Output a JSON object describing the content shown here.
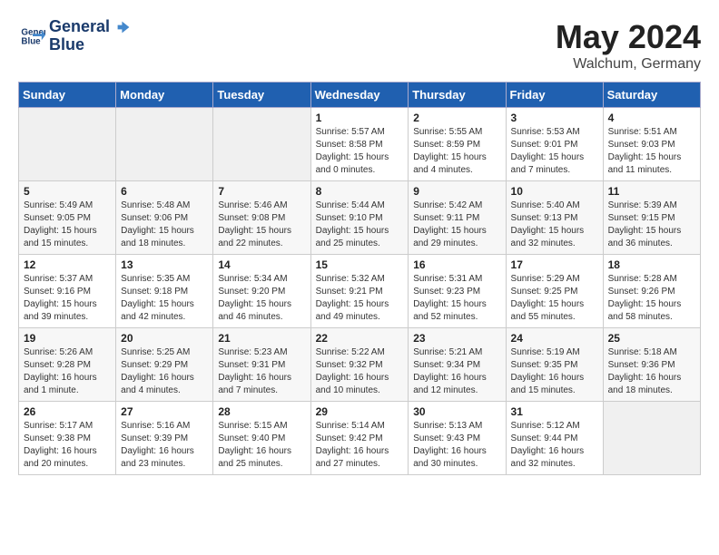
{
  "header": {
    "logo_line1": "General",
    "logo_line2": "Blue",
    "month": "May 2024",
    "location": "Walchum, Germany"
  },
  "weekdays": [
    "Sunday",
    "Monday",
    "Tuesday",
    "Wednesday",
    "Thursday",
    "Friday",
    "Saturday"
  ],
  "weeks": [
    [
      {
        "day": "",
        "info": ""
      },
      {
        "day": "",
        "info": ""
      },
      {
        "day": "",
        "info": ""
      },
      {
        "day": "1",
        "info": "Sunrise: 5:57 AM\nSunset: 8:58 PM\nDaylight: 15 hours\nand 0 minutes."
      },
      {
        "day": "2",
        "info": "Sunrise: 5:55 AM\nSunset: 8:59 PM\nDaylight: 15 hours\nand 4 minutes."
      },
      {
        "day": "3",
        "info": "Sunrise: 5:53 AM\nSunset: 9:01 PM\nDaylight: 15 hours\nand 7 minutes."
      },
      {
        "day": "4",
        "info": "Sunrise: 5:51 AM\nSunset: 9:03 PM\nDaylight: 15 hours\nand 11 minutes."
      }
    ],
    [
      {
        "day": "5",
        "info": "Sunrise: 5:49 AM\nSunset: 9:05 PM\nDaylight: 15 hours\nand 15 minutes."
      },
      {
        "day": "6",
        "info": "Sunrise: 5:48 AM\nSunset: 9:06 PM\nDaylight: 15 hours\nand 18 minutes."
      },
      {
        "day": "7",
        "info": "Sunrise: 5:46 AM\nSunset: 9:08 PM\nDaylight: 15 hours\nand 22 minutes."
      },
      {
        "day": "8",
        "info": "Sunrise: 5:44 AM\nSunset: 9:10 PM\nDaylight: 15 hours\nand 25 minutes."
      },
      {
        "day": "9",
        "info": "Sunrise: 5:42 AM\nSunset: 9:11 PM\nDaylight: 15 hours\nand 29 minutes."
      },
      {
        "day": "10",
        "info": "Sunrise: 5:40 AM\nSunset: 9:13 PM\nDaylight: 15 hours\nand 32 minutes."
      },
      {
        "day": "11",
        "info": "Sunrise: 5:39 AM\nSunset: 9:15 PM\nDaylight: 15 hours\nand 36 minutes."
      }
    ],
    [
      {
        "day": "12",
        "info": "Sunrise: 5:37 AM\nSunset: 9:16 PM\nDaylight: 15 hours\nand 39 minutes."
      },
      {
        "day": "13",
        "info": "Sunrise: 5:35 AM\nSunset: 9:18 PM\nDaylight: 15 hours\nand 42 minutes."
      },
      {
        "day": "14",
        "info": "Sunrise: 5:34 AM\nSunset: 9:20 PM\nDaylight: 15 hours\nand 46 minutes."
      },
      {
        "day": "15",
        "info": "Sunrise: 5:32 AM\nSunset: 9:21 PM\nDaylight: 15 hours\nand 49 minutes."
      },
      {
        "day": "16",
        "info": "Sunrise: 5:31 AM\nSunset: 9:23 PM\nDaylight: 15 hours\nand 52 minutes."
      },
      {
        "day": "17",
        "info": "Sunrise: 5:29 AM\nSunset: 9:25 PM\nDaylight: 15 hours\nand 55 minutes."
      },
      {
        "day": "18",
        "info": "Sunrise: 5:28 AM\nSunset: 9:26 PM\nDaylight: 15 hours\nand 58 minutes."
      }
    ],
    [
      {
        "day": "19",
        "info": "Sunrise: 5:26 AM\nSunset: 9:28 PM\nDaylight: 16 hours\nand 1 minute."
      },
      {
        "day": "20",
        "info": "Sunrise: 5:25 AM\nSunset: 9:29 PM\nDaylight: 16 hours\nand 4 minutes."
      },
      {
        "day": "21",
        "info": "Sunrise: 5:23 AM\nSunset: 9:31 PM\nDaylight: 16 hours\nand 7 minutes."
      },
      {
        "day": "22",
        "info": "Sunrise: 5:22 AM\nSunset: 9:32 PM\nDaylight: 16 hours\nand 10 minutes."
      },
      {
        "day": "23",
        "info": "Sunrise: 5:21 AM\nSunset: 9:34 PM\nDaylight: 16 hours\nand 12 minutes."
      },
      {
        "day": "24",
        "info": "Sunrise: 5:19 AM\nSunset: 9:35 PM\nDaylight: 16 hours\nand 15 minutes."
      },
      {
        "day": "25",
        "info": "Sunrise: 5:18 AM\nSunset: 9:36 PM\nDaylight: 16 hours\nand 18 minutes."
      }
    ],
    [
      {
        "day": "26",
        "info": "Sunrise: 5:17 AM\nSunset: 9:38 PM\nDaylight: 16 hours\nand 20 minutes."
      },
      {
        "day": "27",
        "info": "Sunrise: 5:16 AM\nSunset: 9:39 PM\nDaylight: 16 hours\nand 23 minutes."
      },
      {
        "day": "28",
        "info": "Sunrise: 5:15 AM\nSunset: 9:40 PM\nDaylight: 16 hours\nand 25 minutes."
      },
      {
        "day": "29",
        "info": "Sunrise: 5:14 AM\nSunset: 9:42 PM\nDaylight: 16 hours\nand 27 minutes."
      },
      {
        "day": "30",
        "info": "Sunrise: 5:13 AM\nSunset: 9:43 PM\nDaylight: 16 hours\nand 30 minutes."
      },
      {
        "day": "31",
        "info": "Sunrise: 5:12 AM\nSunset: 9:44 PM\nDaylight: 16 hours\nand 32 minutes."
      },
      {
        "day": "",
        "info": ""
      }
    ]
  ]
}
